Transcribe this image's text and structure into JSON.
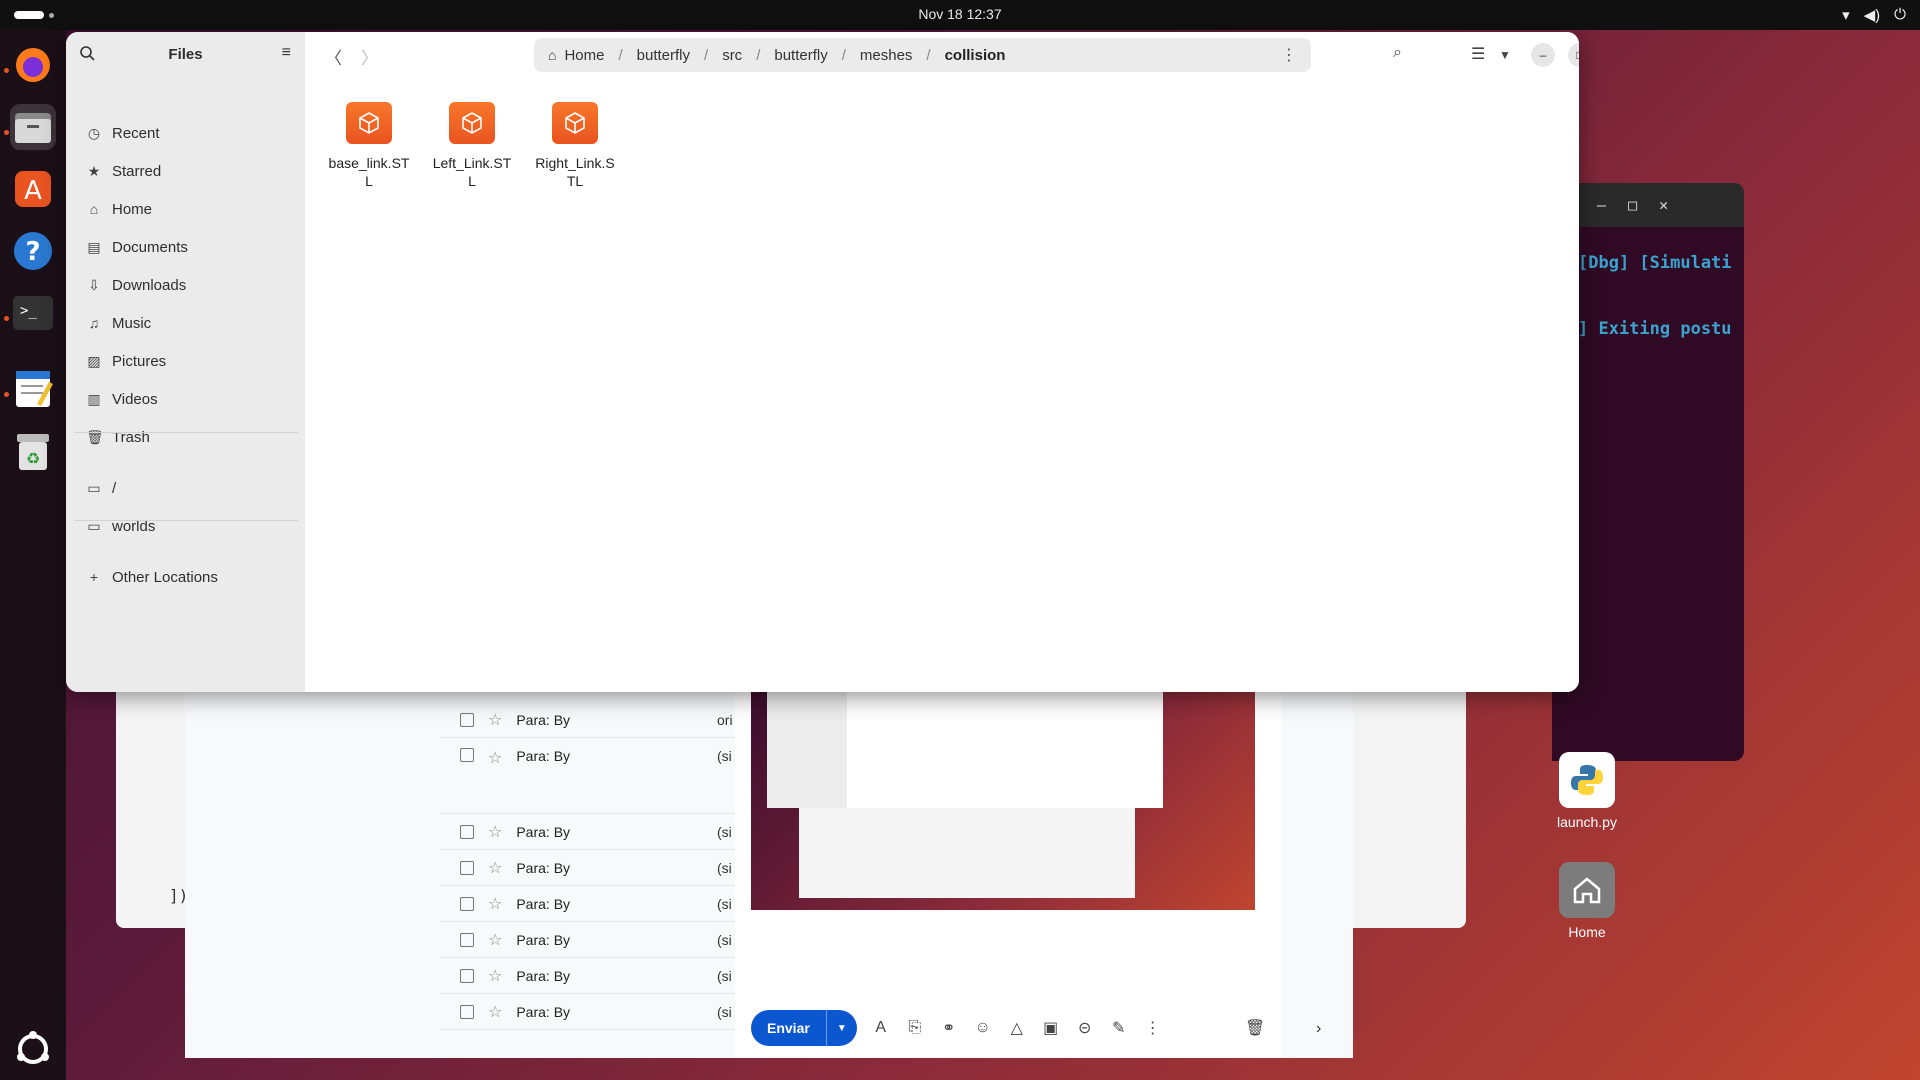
{
  "topbar": {
    "clock": "Nov 18  12:37",
    "tray_icons": [
      "wifi-icon",
      "volume-icon",
      "power-icon"
    ]
  },
  "dock": {
    "items": [
      "firefox",
      "files",
      "app-center",
      "help",
      "terminal",
      "text-editor",
      "trash"
    ]
  },
  "files": {
    "title": "Files",
    "sidebar": {
      "places": [
        {
          "label": "Recent",
          "icon": "clock-icon"
        },
        {
          "label": "Starred",
          "icon": "star-icon"
        },
        {
          "label": "Home",
          "icon": "home-icon"
        },
        {
          "label": "Documents",
          "icon": "document-icon"
        },
        {
          "label": "Downloads",
          "icon": "download-icon"
        },
        {
          "label": "Music",
          "icon": "music-icon"
        },
        {
          "label": "Pictures",
          "icon": "picture-icon"
        },
        {
          "label": "Videos",
          "icon": "video-icon"
        },
        {
          "label": "Trash",
          "icon": "trash-icon"
        }
      ],
      "bookmarks": [
        {
          "label": "/",
          "icon": "folder-icon"
        },
        {
          "label": "worlds",
          "icon": "folder-icon"
        }
      ],
      "other_locations": "Other Locations"
    },
    "breadcrumb": [
      "Home",
      "butterfly",
      "src",
      "butterfly",
      "meshes",
      "collision"
    ],
    "items": [
      {
        "name_line1": "base_link.ST",
        "name_line2": "L"
      },
      {
        "name_line1": "Left_Link.ST",
        "name_line2": "L"
      },
      {
        "name_line1": "Right_Link.S",
        "name_line2": "TL"
      }
    ]
  },
  "terminal": {
    "line1": "[Dbg] [Simulati",
    "line2": "] Exiting postu"
  },
  "mail": {
    "rows": [
      {
        "sender": "Para: By",
        "snippet": "ori"
      },
      {
        "sender": "Para: By",
        "snippet": "(si"
      },
      {
        "sender": "Para: By",
        "snippet": "(si"
      },
      {
        "sender": "Para: By",
        "snippet": "(si"
      },
      {
        "sender": "Para: By",
        "snippet": "(si"
      },
      {
        "sender": "Para: By",
        "snippet": "(si"
      },
      {
        "sender": "Para: By",
        "snippet": "(si"
      },
      {
        "sender": "Para: By",
        "snippet": "(si"
      }
    ],
    "send_label": "Enviar",
    "stray_text": "])"
  },
  "desktop": {
    "icons": [
      {
        "label": "launch.py"
      },
      {
        "label": "Home"
      }
    ]
  }
}
